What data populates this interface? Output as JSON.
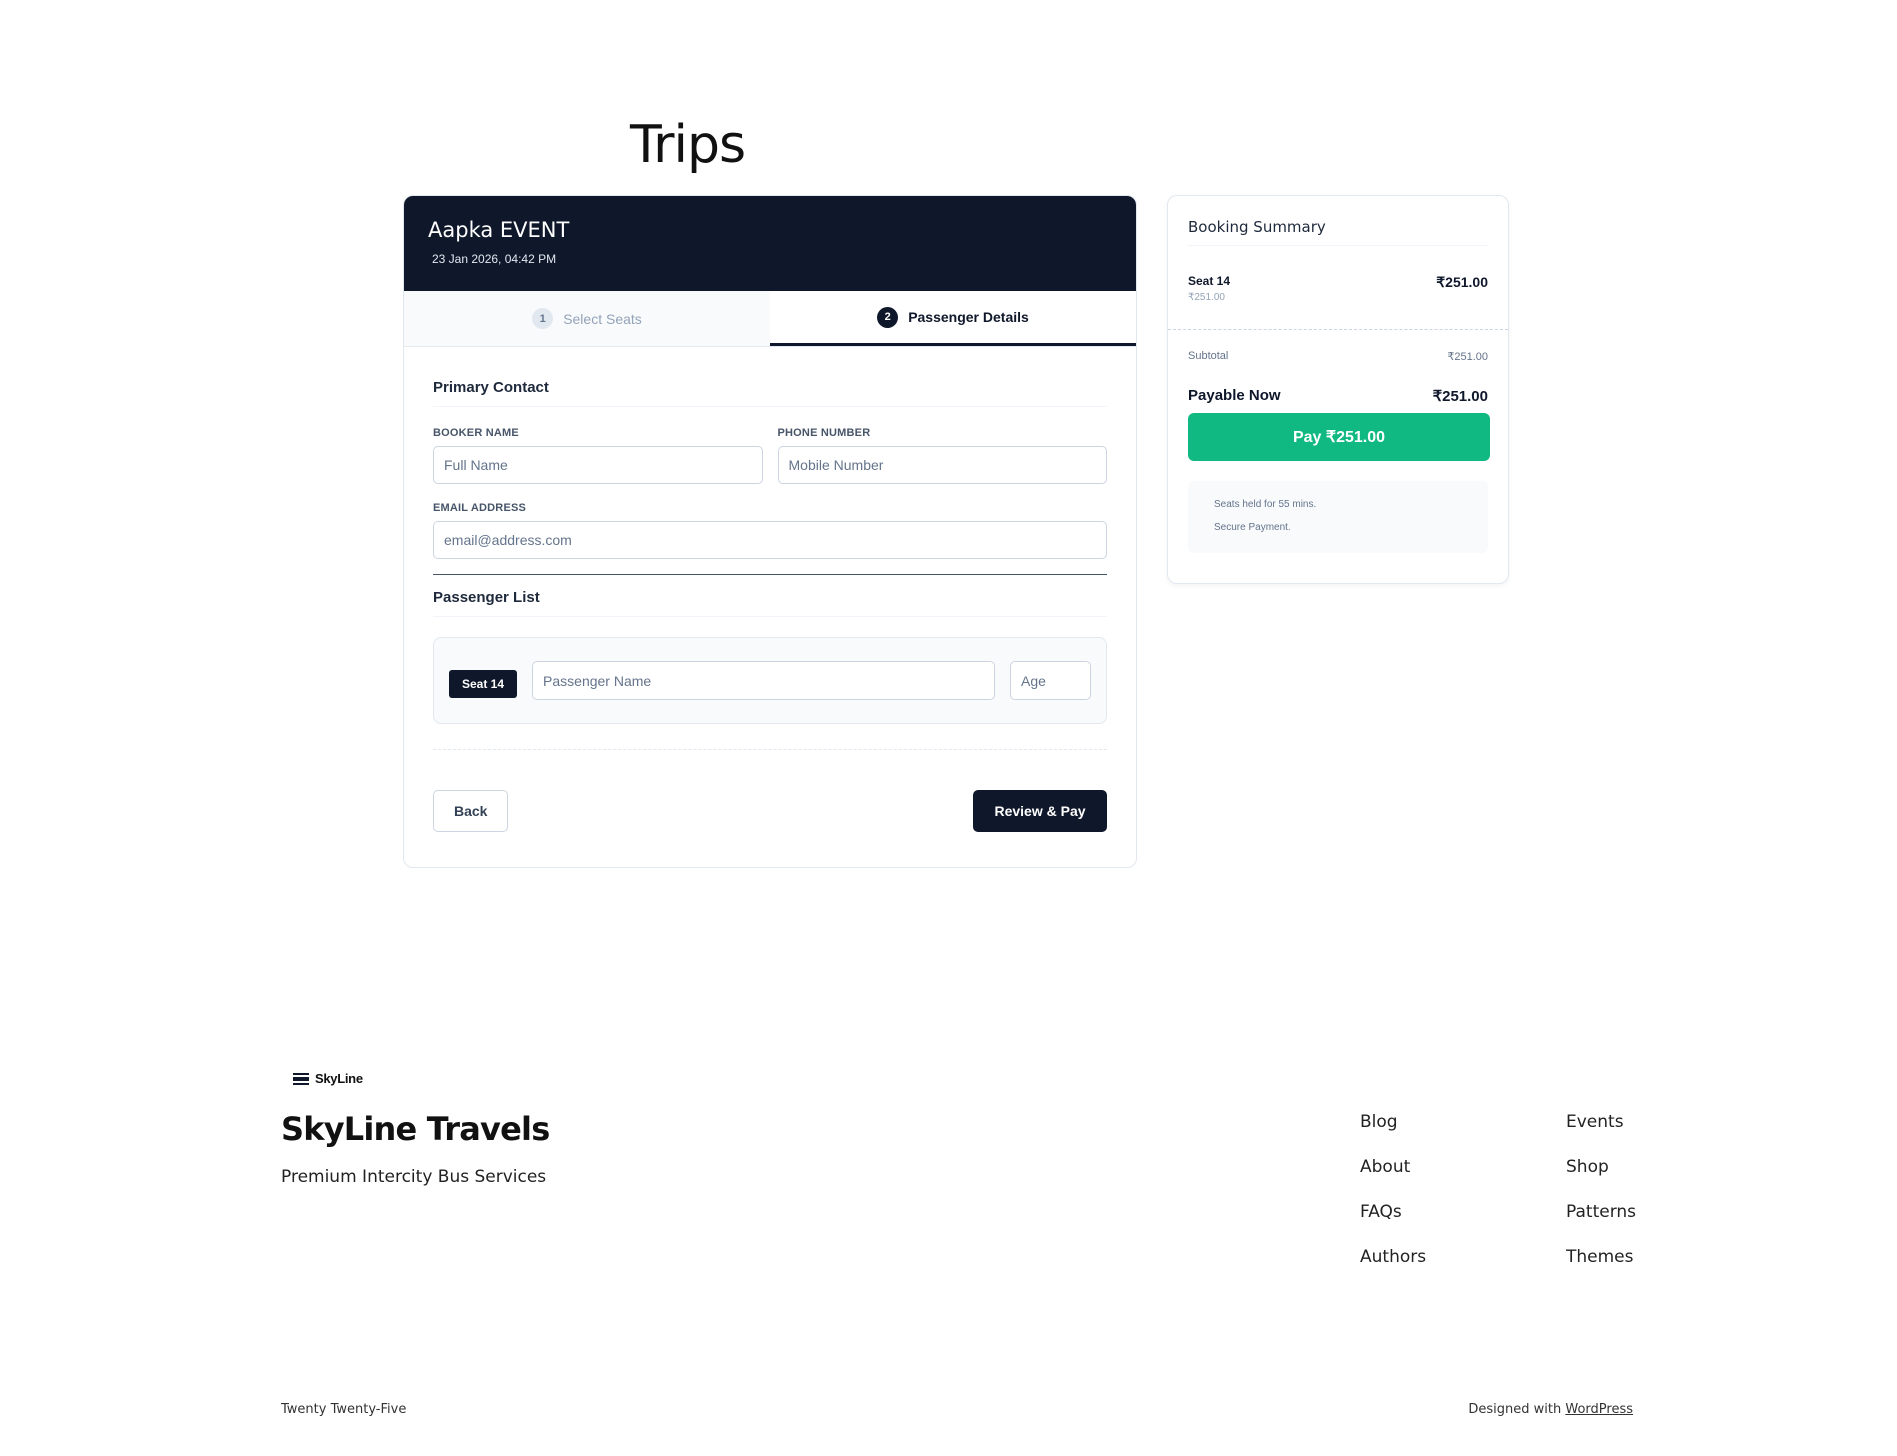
{
  "page": {
    "title": "Trips"
  },
  "trip": {
    "name": "Aapka EVENT",
    "datetime": "23 Jan 2026, 04:42 PM"
  },
  "steps": [
    {
      "number": "1",
      "label": "Select Seats",
      "active": false
    },
    {
      "number": "2",
      "label": "Passenger Details",
      "active": true
    }
  ],
  "contact": {
    "title": "Primary Contact",
    "booker_label": "BOOKER NAME",
    "booker_placeholder": "Full Name",
    "phone_label": "PHONE NUMBER",
    "phone_placeholder": "Mobile Number",
    "email_label": "EMAIL ADDRESS",
    "email_placeholder": "email@address.com"
  },
  "passengers": {
    "title": "Passenger List",
    "list": [
      {
        "seat": "Seat 14",
        "name_placeholder": "Passenger Name",
        "age_placeholder": "Age"
      }
    ]
  },
  "actions": {
    "back": "Back",
    "review": "Review & Pay"
  },
  "summary": {
    "title": "Booking Summary",
    "item_name": "Seat 14",
    "item_sub": "₹251.00",
    "item_price": "₹251.00",
    "subtotal_label": "Subtotal",
    "subtotal_value": "₹251.00",
    "payable_label": "Payable Now",
    "payable_value": "₹251.00",
    "pay_button": "Pay ₹251.00",
    "notice_1": "Seats held for 55 mins.",
    "notice_2": "Secure Payment."
  },
  "footer": {
    "logo_text": "SkyLine",
    "brand": "SkyLine Travels",
    "tagline": "Premium Intercity Bus Services",
    "nav_col1": [
      "Blog",
      "About",
      "FAQs",
      "Authors"
    ],
    "nav_col2": [
      "Events",
      "Shop",
      "Patterns",
      "Themes"
    ],
    "theme": "Twenty Twenty-Five",
    "credit_prefix": "Designed with ",
    "credit_link": "WordPress"
  },
  "colors": {
    "primary": "#0f172a",
    "accent": "#10b981",
    "border": "#e2e8f0"
  }
}
